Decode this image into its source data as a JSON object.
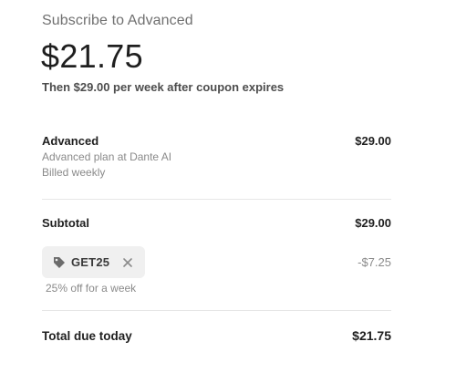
{
  "header": {
    "title": "Subscribe to Advanced",
    "price": "$21.75",
    "then_note": "Then $29.00 per week after coupon expires"
  },
  "line_item": {
    "name": "Advanced",
    "description": "Advanced plan at Dante AI",
    "billing": "Billed weekly",
    "amount": "$29.00"
  },
  "subtotal": {
    "label": "Subtotal",
    "amount": "$29.00"
  },
  "coupon": {
    "code": "GET25",
    "discount": "-$7.25",
    "note": "25% off for a week",
    "icon": "tag-icon",
    "remove_icon": "close-icon"
  },
  "total": {
    "label": "Total due today",
    "amount": "$21.75"
  },
  "colors": {
    "muted_text": "#8a8a8a",
    "chip_background": "#f0f0f0",
    "divider": "#e6e6e6"
  }
}
